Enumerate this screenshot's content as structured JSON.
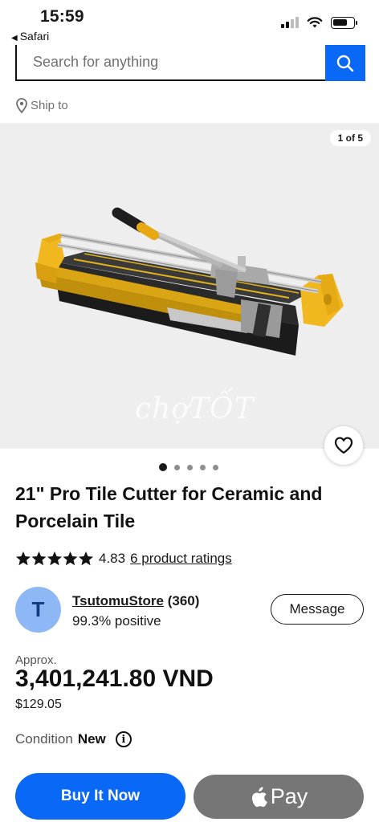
{
  "status_bar": {
    "time": "15:59",
    "back_app": "Safari"
  },
  "search": {
    "placeholder": "Search for anything"
  },
  "ship_to": {
    "label": "Ship to"
  },
  "gallery": {
    "counter": "1 of 5",
    "watermark": "chợTỐT",
    "total_images": 5,
    "active_index": 1
  },
  "product": {
    "title": "21\" Pro Tile Cutter for Ceramic and Porcelain Tile",
    "rating_value": "4.83",
    "rating_stars": 5,
    "ratings_link": "6 product ratings"
  },
  "seller": {
    "avatar_initial": "T",
    "name": "TsutomuStore",
    "feedback_count": "(360)",
    "positive": "99.3% positive",
    "message_label": "Message"
  },
  "price": {
    "approx_label": "Approx.",
    "local": "3,401,241.80 VND",
    "usd": "$129.05"
  },
  "condition": {
    "label": "Condition",
    "value": "New"
  },
  "actions": {
    "buy_now": "Buy It Now",
    "apple_pay": "Pay"
  },
  "colors": {
    "accent_blue": "#0968f6",
    "tool_yellow": "#f0b81e",
    "avatar_blue": "#8eb8f5",
    "apple_pay_gray": "#767676"
  }
}
